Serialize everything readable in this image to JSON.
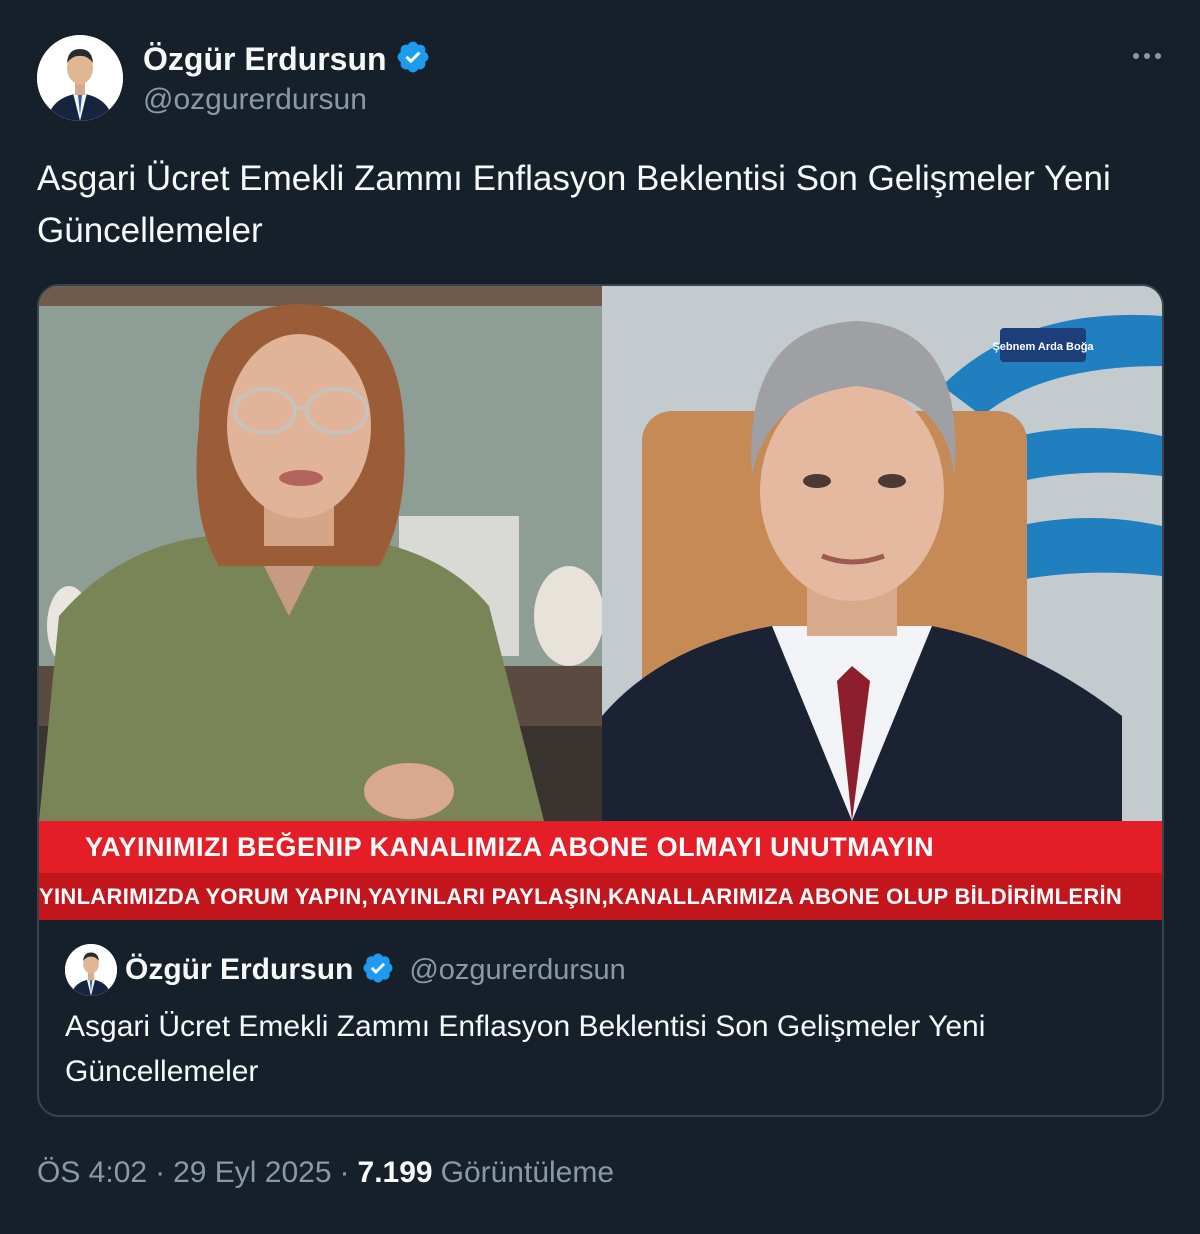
{
  "author": {
    "display_name": "Özgür Erdursun",
    "handle": "@ozgurerdursun",
    "verified": true
  },
  "tweet": {
    "text": "Asgari Ücret Emekli Zammı Enflasyon Beklentisi Son Gelişmeler Yeni Güncellemeler"
  },
  "media": {
    "banner_top": "YAYINIMIZI BEĞENIP KANALIMIZA ABONE OLMAYI UNUTMAYIN",
    "banner_bottom": "YINLARIMIZDA YORUM YAPIN,YAYINLARI PAYLAŞIN,KANALLARIMIZA ABONE OLUP BİLDİRİMLERİN",
    "channel_logo": "Şebnem Arda Boğa"
  },
  "quoted_tweet": {
    "display_name": "Özgür Erdursun",
    "handle": "@ozgurerdursun",
    "text": "Asgari Ücret Emekli Zammı Enflasyon Beklentisi Son Gelişmeler Yeni Güncellemeler"
  },
  "meta": {
    "time": "ÖS 4:02",
    "separator": "·",
    "date": "29 Eyl 2025",
    "views_count": "7.199",
    "views_label": "Görüntüleme"
  },
  "colors": {
    "background": "#15202b",
    "verified_badge": "#1d9bf0",
    "secondary_text": "#8b98a5",
    "banner_red": "#e41e26"
  },
  "icons": [
    "verified-badge-icon",
    "more-options-icon"
  ]
}
